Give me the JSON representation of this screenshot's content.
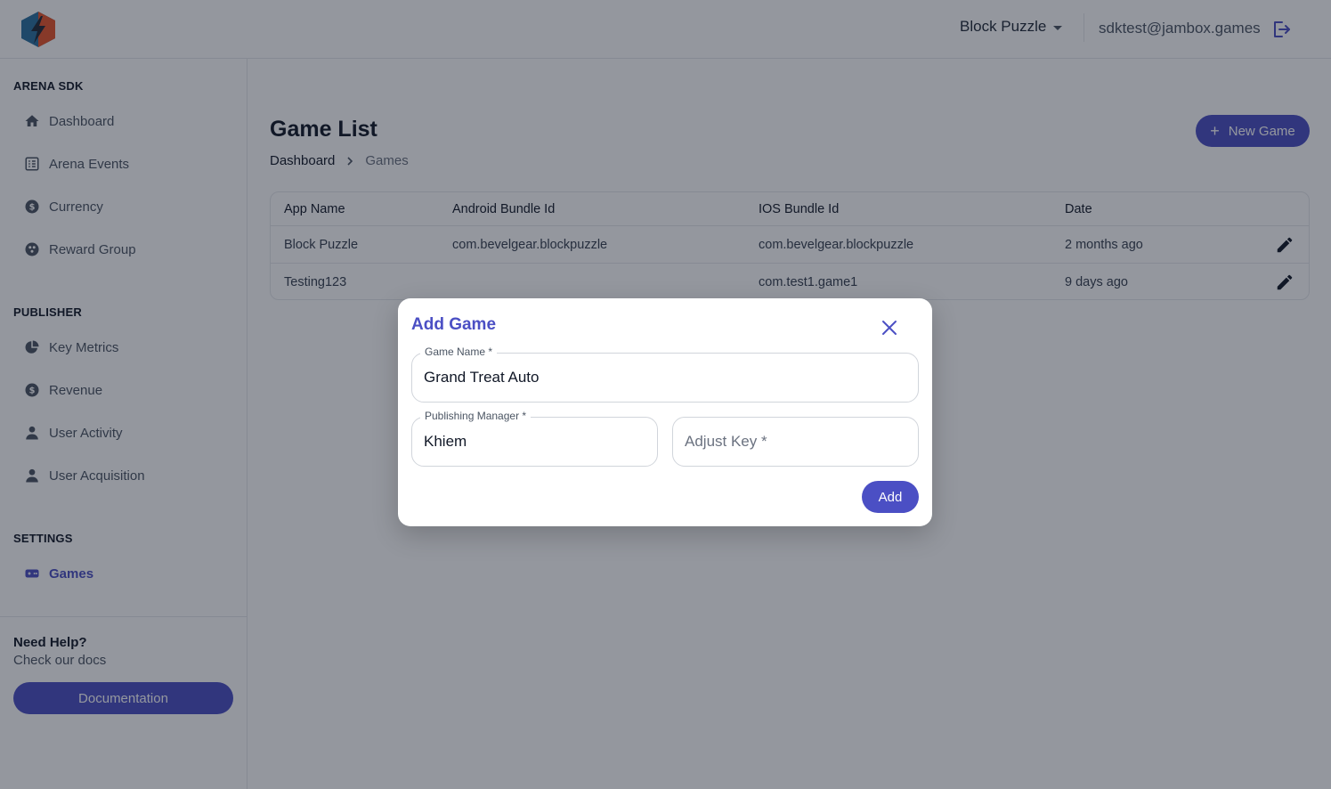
{
  "header": {
    "selected_game": "Block Puzzle",
    "user_email": "sdktest@jambox.games"
  },
  "sidebar": {
    "sections": [
      {
        "title": "ARENA SDK",
        "items": [
          {
            "label": "Dashboard",
            "icon": "home-icon"
          },
          {
            "label": "Arena Events",
            "icon": "events-icon"
          },
          {
            "label": "Currency",
            "icon": "dollar-icon"
          },
          {
            "label": "Reward Group",
            "icon": "reward-icon"
          }
        ]
      },
      {
        "title": "PUBLISHER",
        "items": [
          {
            "label": "Key Metrics",
            "icon": "pie-chart-icon"
          },
          {
            "label": "Revenue",
            "icon": "dollar-icon"
          },
          {
            "label": "User Activity",
            "icon": "user-icon"
          },
          {
            "label": "User Acquisition",
            "icon": "user-icon"
          }
        ]
      },
      {
        "title": "SETTINGS",
        "items": [
          {
            "label": "Games",
            "icon": "gamepad-icon",
            "active": true
          }
        ]
      }
    ],
    "help_title": "Need Help?",
    "help_subtitle": "Check our docs",
    "documentation_label": "Documentation"
  },
  "main": {
    "title": "Game List",
    "breadcrumb": [
      "Dashboard",
      "Games"
    ],
    "new_game_label": "New Game",
    "table": {
      "columns": [
        "App Name",
        "Android Bundle Id",
        "IOS Bundle Id",
        "Date"
      ],
      "rows": [
        [
          "Block Puzzle",
          "com.bevelgear.blockpuzzle",
          "com.bevelgear.blockpuzzle",
          "2 months ago"
        ],
        [
          "Testing123",
          "",
          "com.test1.game1",
          "9 days ago"
        ]
      ]
    }
  },
  "modal": {
    "title": "Add Game",
    "game_name_label": "Game Name *",
    "game_name_value": "Grand Treat Auto",
    "publishing_manager_label": "Publishing Manager *",
    "publishing_manager_value": "Khiem",
    "adjust_key_placeholder": "Adjust Key *",
    "add_label": "Add"
  },
  "colors": {
    "accent": "#4b4fc4",
    "logo_blue": "#2b6f9e",
    "logo_orange": "#e8542b"
  }
}
